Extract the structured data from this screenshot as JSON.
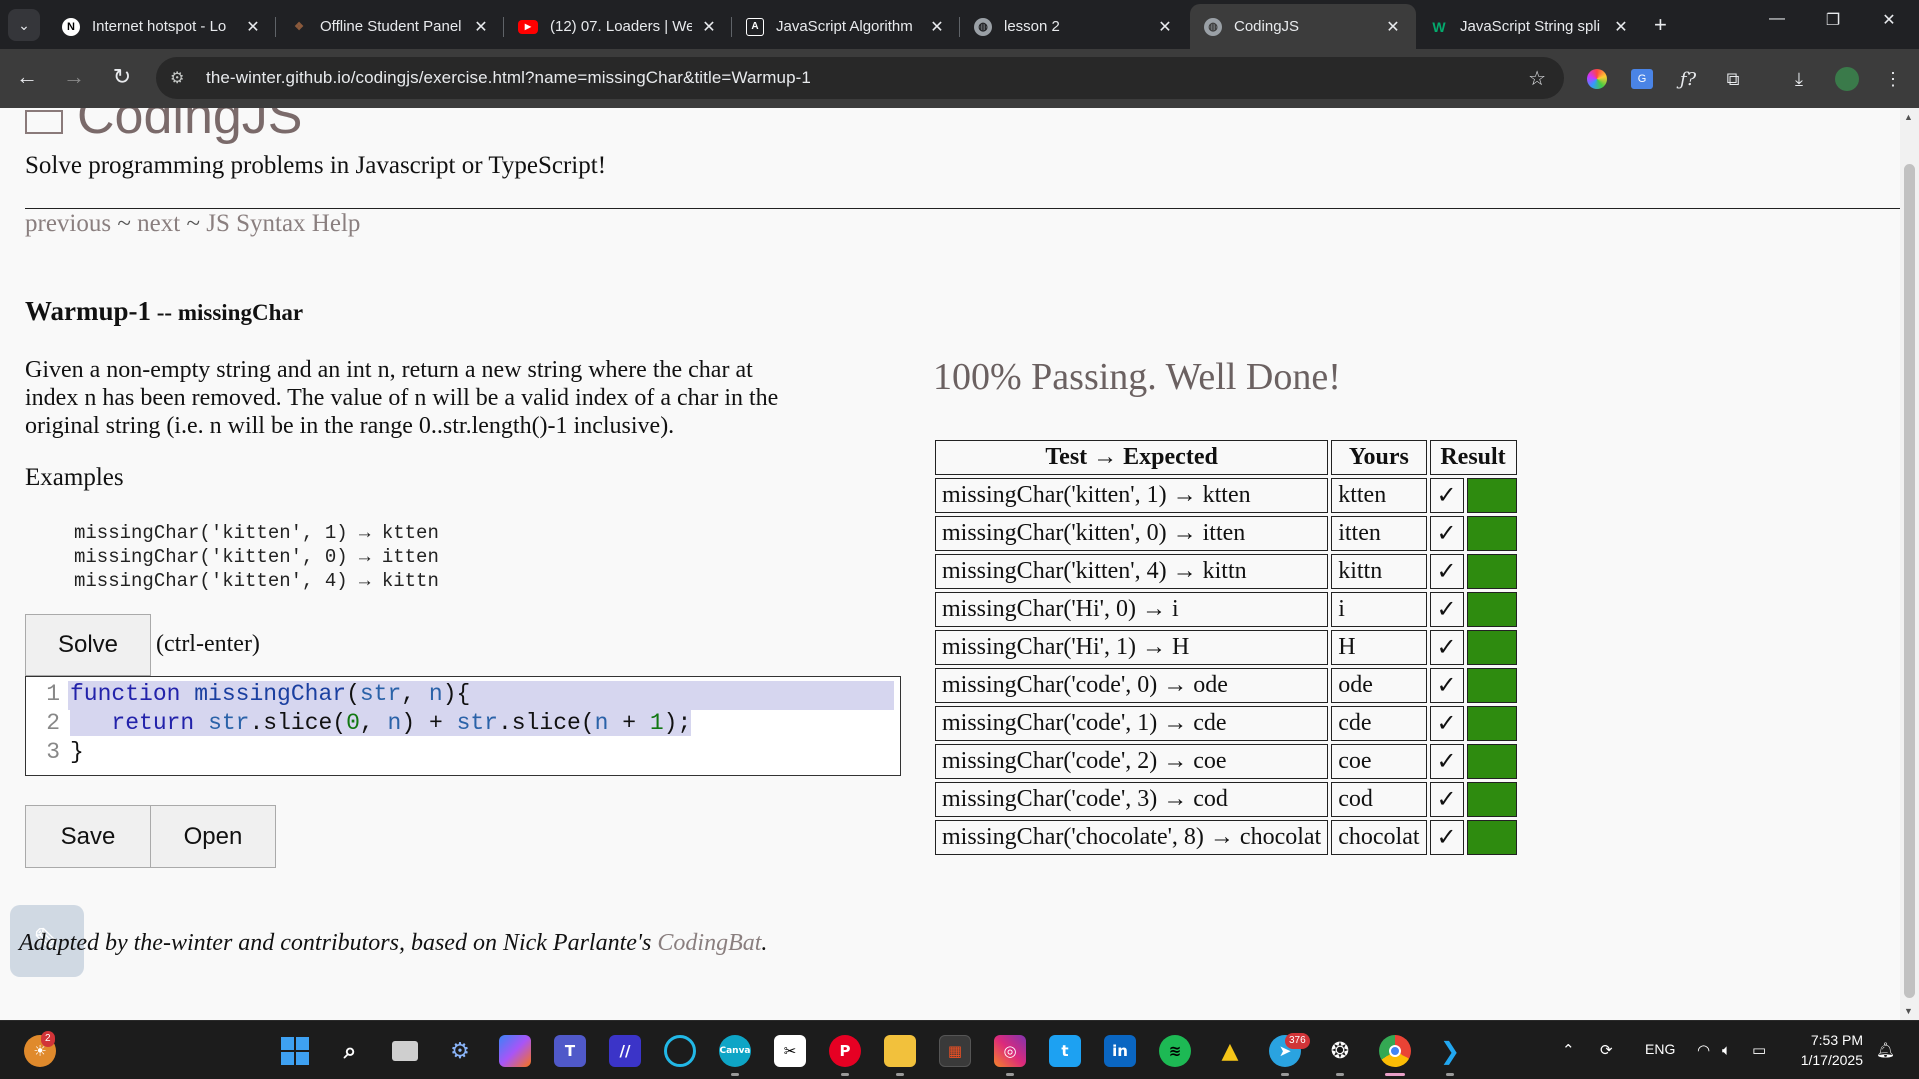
{
  "browser": {
    "tabs": [
      {
        "title": "Internet hotspot - Lo",
        "icon": "notion-icon",
        "color": "#ffffff"
      },
      {
        "title": "Offline Student Panel",
        "icon": "student-panel-icon",
        "color": "#8b5a3c"
      },
      {
        "title": "(12) 07. Loaders | We",
        "icon": "youtube-icon",
        "color": "#ff0000"
      },
      {
        "title": "JavaScript Algorithm",
        "icon": "anthropic-icon",
        "color": "#ffffff"
      },
      {
        "title": "lesson 2",
        "icon": "globe-icon",
        "color": "#9aa0a6"
      },
      {
        "title": "CodingJS",
        "icon": "globe-icon",
        "color": "#9aa0a6"
      },
      {
        "title": "JavaScript String spli",
        "icon": "w3schools-icon",
        "color": "#04aa6d"
      }
    ],
    "url": "the-winter.github.io/codingjs/exercise.html?name=missingChar&title=Warmup-1"
  },
  "page": {
    "logo": "CodingJS",
    "tagline": "Solve programming problems in Javascript or TypeScript!",
    "nav": {
      "previous": "previous",
      "sep": " ~ ",
      "next": "next",
      "help": "JS Syntax Help"
    },
    "title_main": "Warmup-1",
    "title_dash": " -- ",
    "title_name": "missingChar",
    "description": "Given a non-empty string and an int n, return a new string where the char at index n has been removed. The value of n will be a valid index of a char in the original string (i.e. n will be in the range 0..str.length()-1 inclusive).",
    "examples_heading": "Examples",
    "examples": [
      "missingChar('kitten', 1) → ktten",
      "missingChar('kitten', 0) → itten",
      "missingChar('kitten', 4) → kittn"
    ],
    "solve_label": "Solve",
    "solve_hint": "(ctrl-enter)",
    "save_label": "Save",
    "open_label": "Open",
    "code_lines": [
      "1",
      "2",
      "3"
    ],
    "footer_text": "Adapted by the-winter and contributors, based on Nick Parlante's ",
    "footer_link": "CodingBat",
    "footer_end": ".",
    "passing": "100% Passing. Well Done!",
    "table_headers": [
      "Test → Expected",
      "Yours",
      "Result"
    ],
    "results": [
      {
        "test": "missingChar('kitten', 1) → ktten",
        "yours": "ktten",
        "mark": "✓"
      },
      {
        "test": "missingChar('kitten', 0) → itten",
        "yours": "itten",
        "mark": "✓"
      },
      {
        "test": "missingChar('kitten', 4) → kittn",
        "yours": "kittn",
        "mark": "✓"
      },
      {
        "test": "missingChar('Hi', 0) → i",
        "yours": "i",
        "mark": "✓"
      },
      {
        "test": "missingChar('Hi', 1) → H",
        "yours": "H",
        "mark": "✓"
      },
      {
        "test": "missingChar('code', 0) → ode",
        "yours": "ode",
        "mark": "✓"
      },
      {
        "test": "missingChar('code', 1) → cde",
        "yours": "cde",
        "mark": "✓"
      },
      {
        "test": "missingChar('code', 2) → coe",
        "yours": "coe",
        "mark": "✓"
      },
      {
        "test": "missingChar('code', 3) → cod",
        "yours": "cod",
        "mark": "✓"
      },
      {
        "test": "missingChar('chocolate', 8) → chocolat",
        "yours": "chocolat",
        "mark": "✓"
      }
    ],
    "pass_color": "#2e8b0f"
  },
  "taskbar": {
    "time": "7:53 PM",
    "date": "1/17/2025",
    "language": "ENG",
    "widget_badge": "2",
    "telegram_badge": "376"
  }
}
